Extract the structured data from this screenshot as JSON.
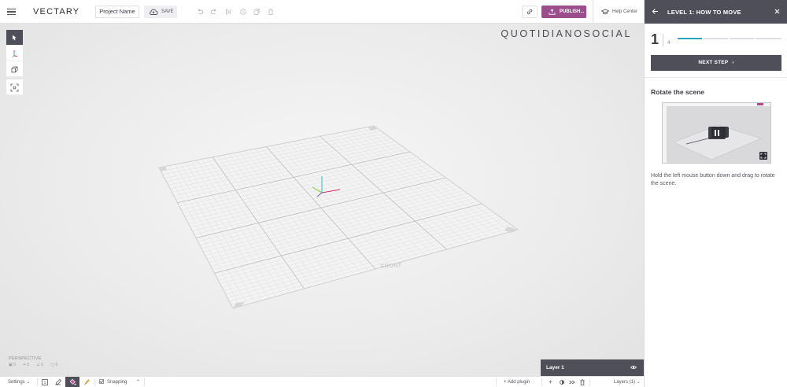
{
  "app": {
    "logo": "VECTARY",
    "project_name": "Project Name",
    "save_label": "SAVE",
    "publish_label": "PUBLISH...",
    "help_label": "Help Center",
    "accent_color": "#9b4e8c"
  },
  "viewport": {
    "watermark": "QUOTIDIANOSOCIAL",
    "camera_mode": "PERSPECTIVE",
    "stats": [
      "0",
      "0",
      "0",
      "0"
    ],
    "front_label": "FRONT"
  },
  "layers_panel": {
    "layer_name": "Layer 1"
  },
  "bottom_bar": {
    "settings_label": "Settings",
    "snapping_label": "Snapping",
    "add_plugin_label": "Add plugin",
    "layers_label": "Layers (1)"
  },
  "tutorial": {
    "title": "LEVEL 1: HOW TO MOVE",
    "current_step": "1",
    "total_steps": "4",
    "progress_fraction": 0.25,
    "next_button_label": "NEXT STEP",
    "section_title": "Rotate the scene",
    "description": "Hold the left mouse button down and drag to rotate the scene."
  }
}
